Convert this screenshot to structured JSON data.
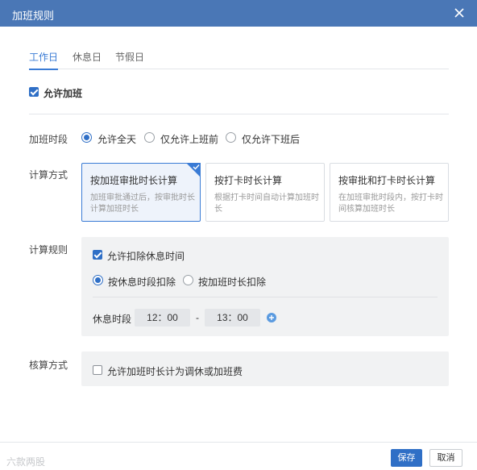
{
  "dialog": {
    "title": "加班规则"
  },
  "tabs": [
    {
      "label": "工作日",
      "active": true
    },
    {
      "label": "休息日",
      "active": false
    },
    {
      "label": "节假日",
      "active": false
    }
  ],
  "allow_overtime": {
    "label": "允许加班",
    "checked": true
  },
  "time_period": {
    "label": "加班时段",
    "options": [
      {
        "label": "允许全天",
        "selected": true
      },
      {
        "label": "仅允许上班前",
        "selected": false
      },
      {
        "label": "仅允许下班后",
        "selected": false
      }
    ]
  },
  "calc_method": {
    "label": "计算方式",
    "cards": [
      {
        "title": "按加班审批时长计算",
        "desc": "加班审批通过后，按审批时长计算加班时长",
        "selected": true
      },
      {
        "title": "按打卡时长计算",
        "desc": "根据打卡时间自动计算加班时长",
        "selected": false
      },
      {
        "title": "按审批和打卡时长计算",
        "desc": "在加班审批时段内，按打卡时间核算加班时长",
        "selected": false
      }
    ]
  },
  "calc_rule": {
    "label": "计算规则",
    "deduct_break": {
      "label": "允许扣除休息时间",
      "checked": true
    },
    "deduct_options": [
      {
        "label": "按休息时段扣除",
        "selected": true
      },
      {
        "label": "按加班时长扣除",
        "selected": false
      }
    ],
    "break_period": {
      "label": "休息时段",
      "start": "12：00",
      "separator": "-",
      "end": "13：00"
    }
  },
  "accounting": {
    "label": "核算方式",
    "option": {
      "label": "允许加班时长计为调休或加班费",
      "checked": false
    }
  },
  "footer": {
    "save": "保存",
    "cancel": "取消",
    "watermark": "六款两股"
  },
  "colors": {
    "titlebar": "#4a77b6",
    "accent": "#2f6fc6",
    "panel": "#f1f2f3"
  }
}
